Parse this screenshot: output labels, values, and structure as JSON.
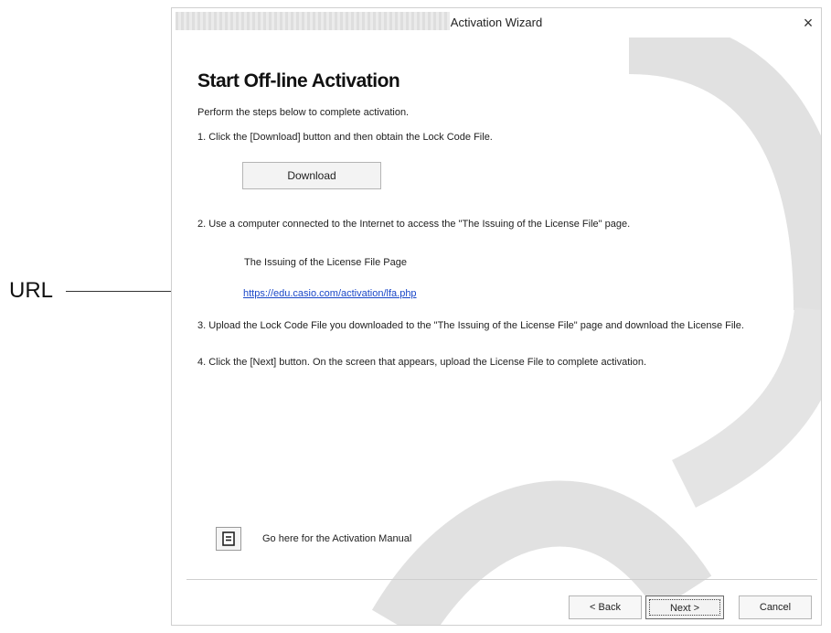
{
  "callout": {
    "label": "URL"
  },
  "window": {
    "title": "Activation Wizard",
    "close_glyph": "×"
  },
  "content": {
    "heading": "Start Off-line Activation",
    "intro": "Perform the steps below to complete activation.",
    "step1": "1. Click the [Download] button and then obtain the Lock Code File.",
    "download_label": "Download",
    "step2": "2. Use a computer connected to the Internet to access the \"The Issuing of the License File\" page.",
    "page_label": "The Issuing of the License File Page",
    "url": "https://edu.casio.com/activation/lfa.php",
    "step3": "3. Upload the Lock Code File you downloaded to the \"The Issuing of the License File\" page and download the License File.",
    "step4": "4. Click the [Next] button. On the screen that appears, upload the License File to complete activation.",
    "manual_text": "Go here for the Activation Manual"
  },
  "icons": {
    "close": "close-icon",
    "manual": "document-icon"
  },
  "footer": {
    "back_label": "< Back",
    "next_label": "Next >",
    "cancel_label": "Cancel"
  },
  "colors": {
    "link": "#1a47c8",
    "watermark": "#dcdcdc"
  }
}
